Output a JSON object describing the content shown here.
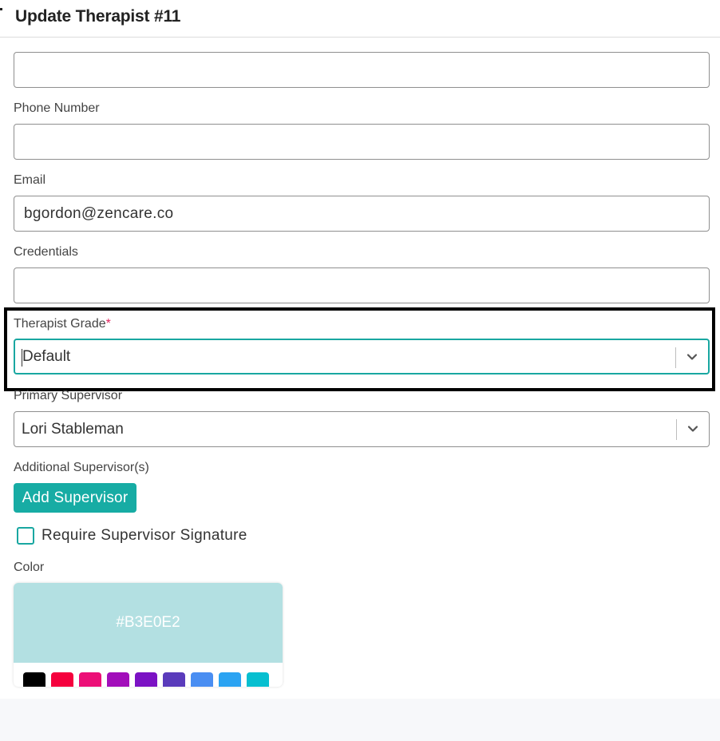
{
  "header": {
    "title": "Update Therapist #11"
  },
  "fields": {
    "top_value": "",
    "phone_label": "Phone Number",
    "phone_value": "",
    "email_label": "Email",
    "email_value": "bgordon@zencare.co",
    "credentials_label": "Credentials",
    "credentials_value": ""
  },
  "therapist_grade": {
    "label": "Therapist Grade",
    "required_mark": "*",
    "value": "Default"
  },
  "primary_supervisor": {
    "label": "Primary Supervisor",
    "value": "Lori Stableman"
  },
  "additional_supervisors": {
    "label": "Additional Supervisor(s)",
    "add_button": "Add Supervisor"
  },
  "require_signature": {
    "label": "Require Supervisor Signature",
    "checked": false
  },
  "color": {
    "label": "Color",
    "hex": "#B3E0E2",
    "preview_color": "#B3E0E2",
    "swatches": [
      "#000000",
      "#f5003d",
      "#ec0f77",
      "#a20eba",
      "#7b12c4",
      "#5a3bbb",
      "#4a8ef2",
      "#2ba3f2",
      "#07bfd0"
    ]
  },
  "theme": {
    "accent": "#17aca4"
  }
}
